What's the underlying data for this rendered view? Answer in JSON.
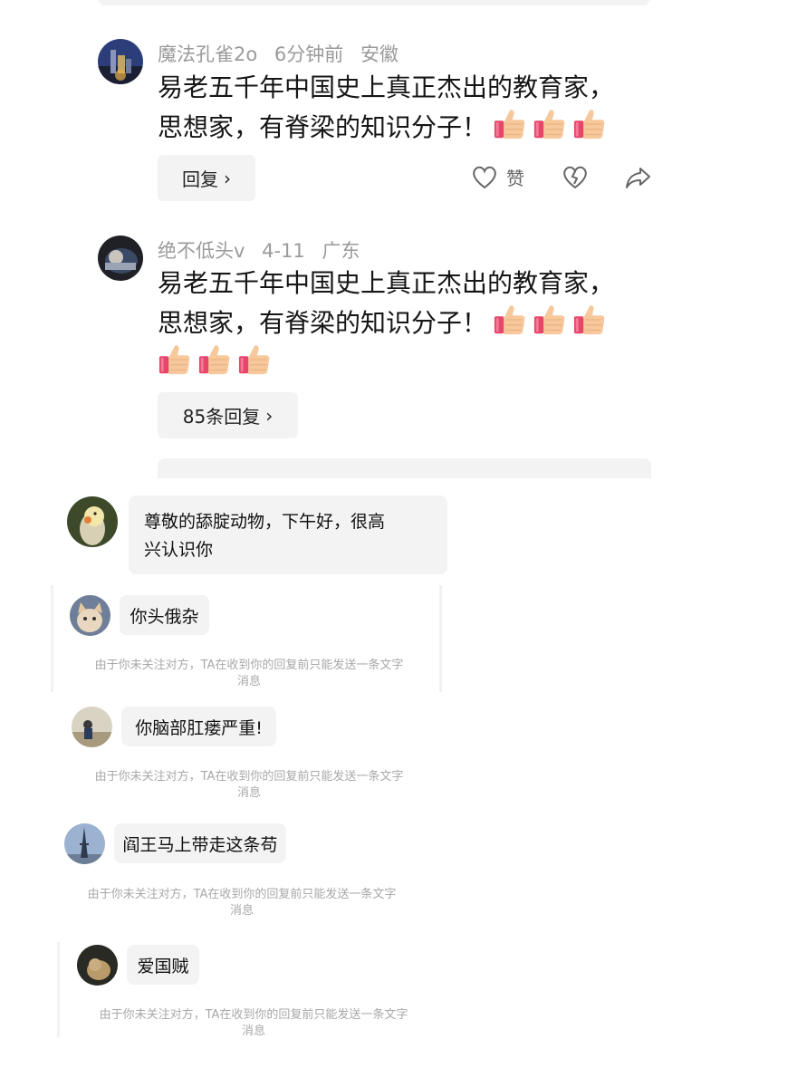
{
  "comments": [
    {
      "user": "魔法孔雀2o",
      "time": "6分钟前",
      "location": "安徽",
      "text_line1": "易老五千年中国史上真正杰出的教育家，",
      "text_line2": "思想家，有脊梁的知识分子！",
      "thumbs_count": 3,
      "reply_label": "回复",
      "like_label": "赞"
    },
    {
      "user": "绝不低头v",
      "time": "4-11",
      "location": "广东",
      "text_line1": "易老五千年中国史上真正杰出的教育家，",
      "text_line2": "思想家，有脊梁的知识分子！",
      "thumbs_count": 6,
      "reply_label": "85条回复"
    }
  ],
  "chats": [
    {
      "message_line1": "尊敬的舔腚动物，下午好，很高",
      "message_line2": "兴认识你"
    },
    {
      "message": "你头俄杂",
      "hint_line1": "由于你未关注对方，TA在收到你的回复前只能发送一条文字",
      "hint_line2": "消息"
    },
    {
      "message": "你脑部肛瘘严重!",
      "hint_line1": "由于你未关注对方，TA在收到你的回复前只能发送一条文字",
      "hint_line2": "消息"
    },
    {
      "message": "阎王马上带走这条苟",
      "hint_line1": "由于你未关注对方，TA在收到你的回复前只能发送一条文字",
      "hint_line2": "消息"
    },
    {
      "message": "爱国贼",
      "hint_line1": "由于你未关注对方，TA在收到你的回复前只能发送一条文字",
      "hint_line2": "消息"
    }
  ],
  "icons": {
    "heart": "heart-icon",
    "dislike": "broken-heart-icon",
    "share": "share-icon",
    "thumb": "thumbs-up-emoji",
    "chevron": "chevron-right-icon"
  },
  "colors": {
    "meta_gray": "#9a9a9a",
    "pill_bg": "#f3f3f3",
    "hint_gray": "#a8a8a8"
  }
}
